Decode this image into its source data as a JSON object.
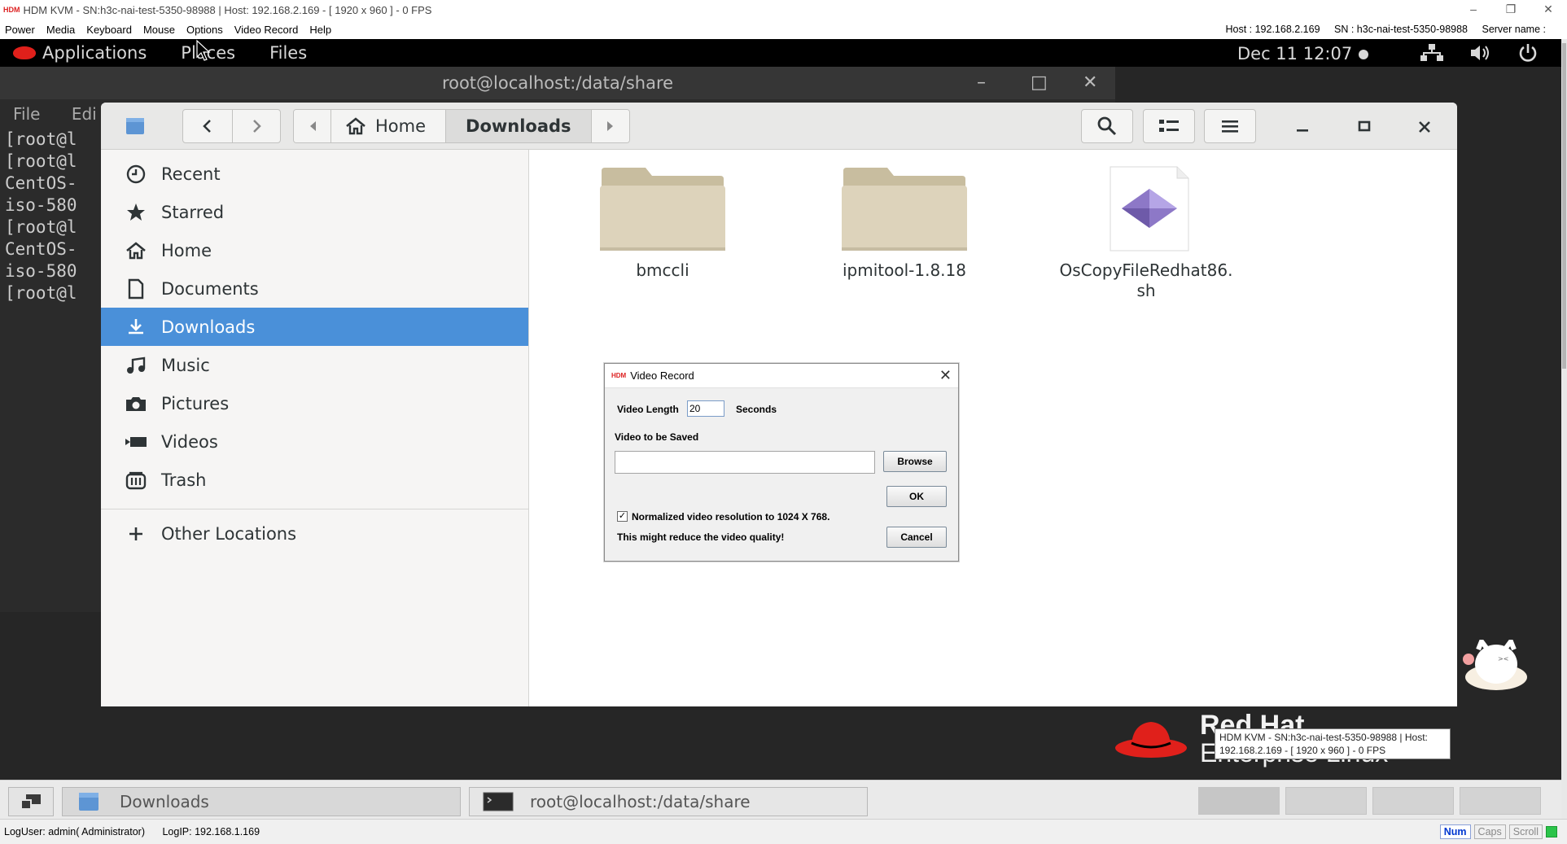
{
  "kvm": {
    "title": "HDM KVM - SN:h3c-nai-test-5350-98988 | Host: 192.168.2.169 - [ 1920 x 960 ] - 0 FPS",
    "logo": "HDM",
    "menu": [
      "Power",
      "Media",
      "Keyboard",
      "Mouse",
      "Options",
      "Video Record",
      "Help"
    ],
    "host_label": "Host : 192.168.2.169",
    "sn_label": "SN : h3c-nai-test-5350-98988",
    "server_label": "Server name :"
  },
  "gnome": {
    "applications": "Applications",
    "places": "Places",
    "files": "Files",
    "clock": "Dec 11  12:07"
  },
  "terminal": {
    "title": "root@localhost:/data/share",
    "menu": [
      "File",
      "Edi"
    ],
    "lines": [
      "[root@l",
      "[root@l",
      "CentOS-",
      "iso-580",
      "[root@l",
      "CentOS-",
      "iso-580",
      "[root@l"
    ]
  },
  "files": {
    "path": {
      "home": "Home",
      "current": "Downloads"
    },
    "sidebar": [
      {
        "label": "Recent",
        "icon": "clock-icon"
      },
      {
        "label": "Starred",
        "icon": "star-icon"
      },
      {
        "label": "Home",
        "icon": "home-icon"
      },
      {
        "label": "Documents",
        "icon": "document-icon"
      },
      {
        "label": "Downloads",
        "icon": "download-icon"
      },
      {
        "label": "Music",
        "icon": "music-icon"
      },
      {
        "label": "Pictures",
        "icon": "camera-icon"
      },
      {
        "label": "Videos",
        "icon": "video-icon"
      },
      {
        "label": "Trash",
        "icon": "trash-icon"
      }
    ],
    "other_locations": "Other Locations",
    "items": [
      {
        "name": "bmccli",
        "type": "folder"
      },
      {
        "name": "ipmitool-1.8.18",
        "type": "folder"
      },
      {
        "name_line1": "OsCopyFileRedhat86.",
        "name_line2": "sh",
        "type": "script"
      }
    ]
  },
  "dialog": {
    "logo": "HDM",
    "title": "Video Record",
    "video_length_label": "Video Length",
    "video_length_value": "20",
    "seconds_label": "Seconds",
    "save_label": "Video to be Saved",
    "save_path": "",
    "browse": "Browse",
    "ok": "OK",
    "normalize_label": "Normalized video resolution to 1024 X 768.",
    "normalize_checked": true,
    "warning": "This might reduce the video quality!",
    "cancel": "Cancel"
  },
  "redhat": {
    "line1": "Red Hat",
    "line2": "Enterprise Linux"
  },
  "taskbar": {
    "windows": [
      "Downloads",
      "root@localhost:/data/share"
    ]
  },
  "tooltip": {
    "line1": "HDM KVM - SN:h3c-nai-test-5350-98988 | Host:",
    "line2": "192.168.2.169 - [ 1920 x 960 ] - 0 FPS"
  },
  "status": {
    "user": "LogUser: admin( Administrator)",
    "ip": "LogIP: 192.168.1.169",
    "keys": [
      "Num",
      "Caps",
      "Scroll"
    ],
    "num_on": true
  },
  "colors": {
    "accent": "#4a90d9",
    "redhat": "#e0201b",
    "folder": "#d9cfb6"
  }
}
